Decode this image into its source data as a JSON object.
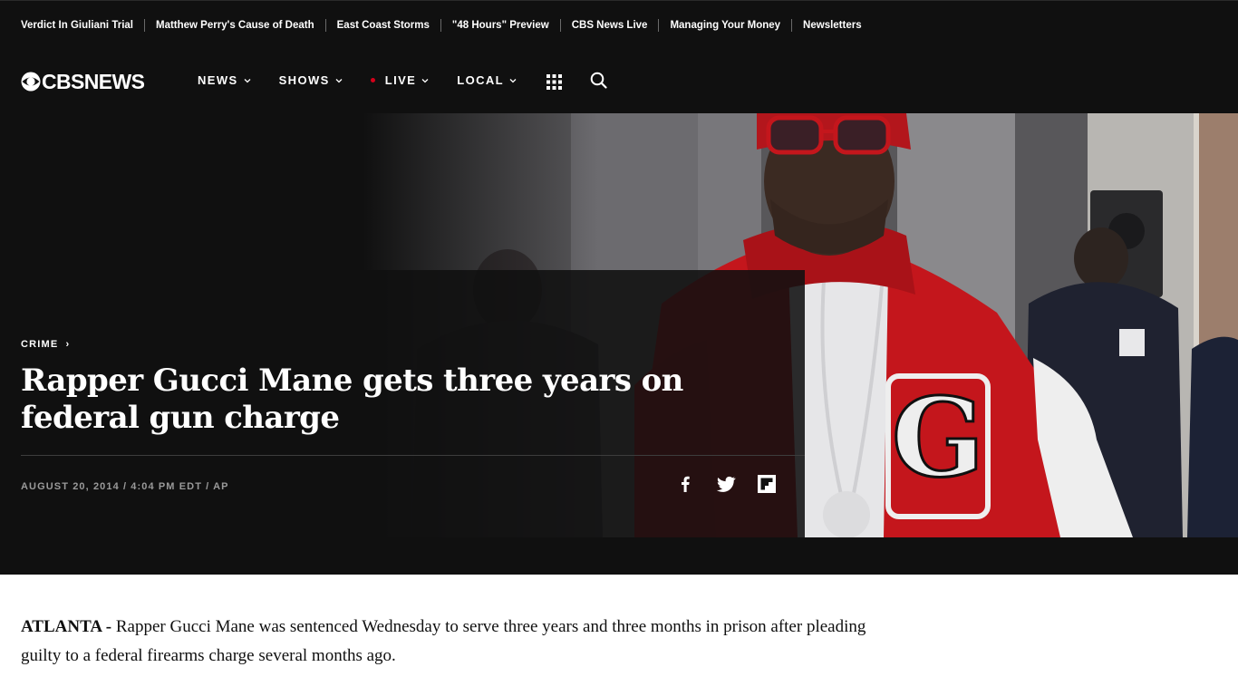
{
  "trending": [
    "Verdict In Giuliani Trial",
    "Matthew Perry's Cause of Death",
    "East Coast Storms",
    "\"48 Hours\" Preview",
    "CBS News Live",
    "Managing Your Money",
    "Newsletters"
  ],
  "brand": {
    "logo_text": "CBSNEWS",
    "accent": "#d4001a",
    "background": "#101010"
  },
  "nav": {
    "news": "NEWS",
    "shows": "SHOWS",
    "live": "LIVE",
    "local": "LOCAL"
  },
  "icons": {
    "apps": "grid-icon",
    "search": "search-icon",
    "facebook": "facebook-icon",
    "twitter": "twitter-icon",
    "flipboard": "flipboard-icon",
    "chevron": "chevron-down-icon",
    "breadcrumb": "chevron-right-icon"
  },
  "hero": {
    "category": "CRIME",
    "category_arrow": "›",
    "headline": "Rapper Gucci Mane gets three years on federal gun charge",
    "byline": "AUGUST 20, 2014 / 4:04 PM EDT / AP",
    "photo_letter": "G"
  },
  "article": {
    "dateline": "ATLANTA -",
    "body": " Rapper Gucci Mane was sentenced Wednesday to serve three years and three months in prison after pleading guilty to a federal firearms charge several months ago."
  }
}
